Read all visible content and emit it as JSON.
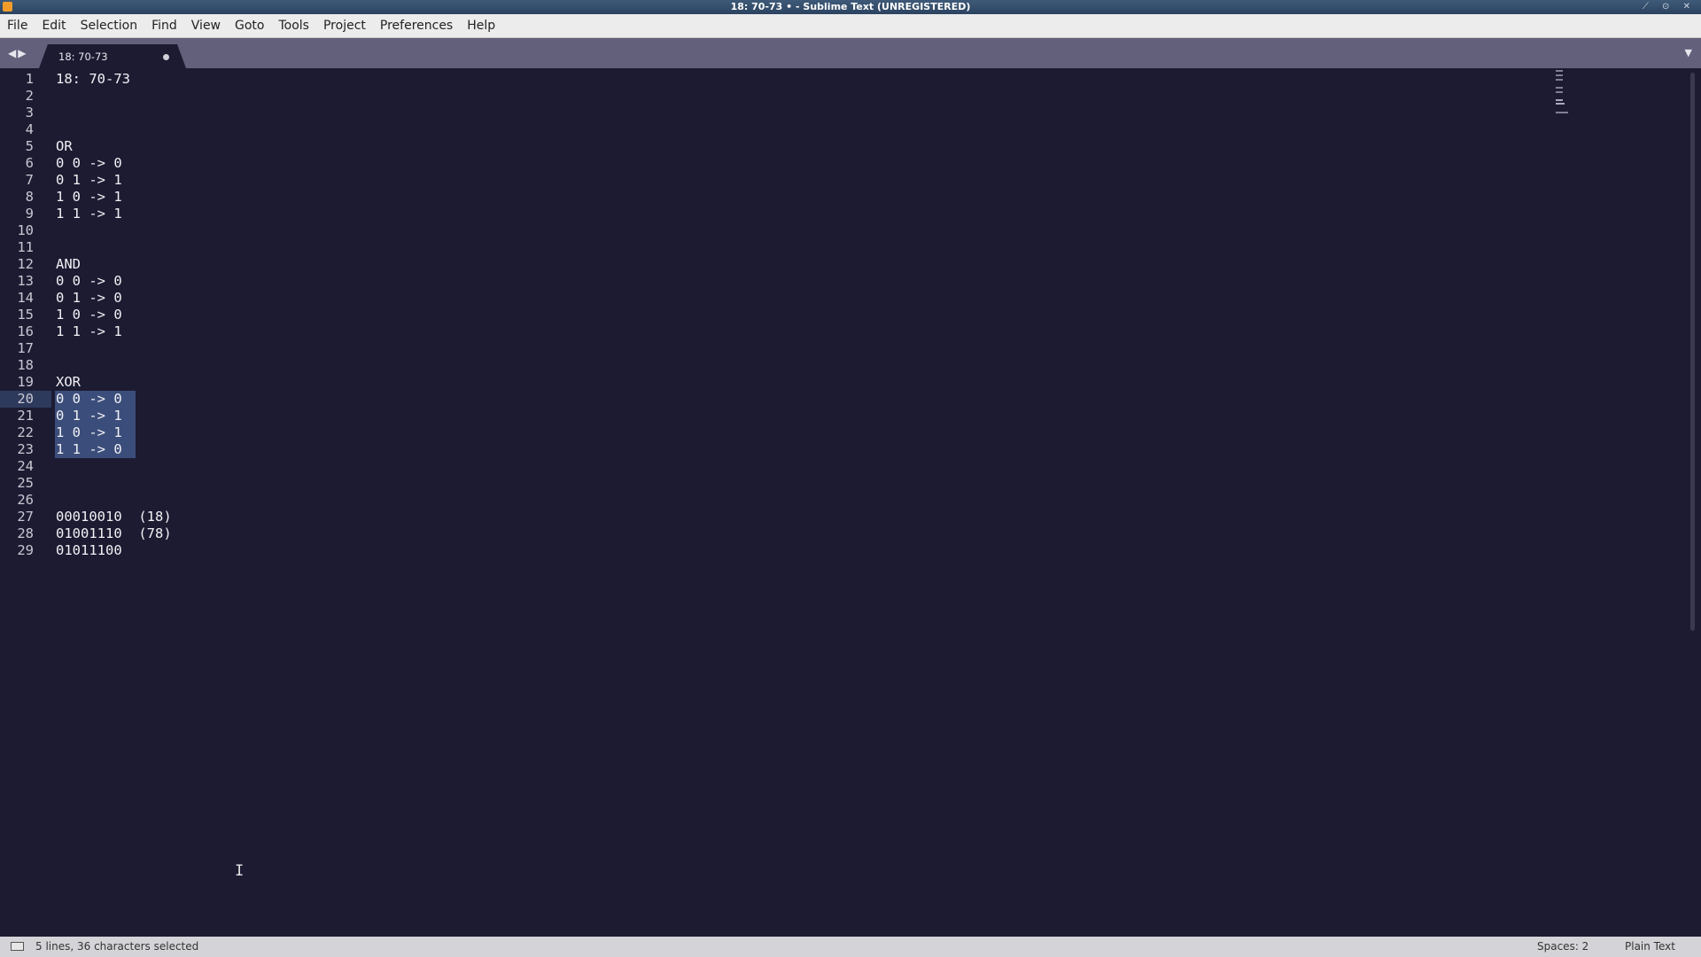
{
  "window": {
    "title": "18: 70-73 • - Sublime Text (UNREGISTERED)",
    "controls": "⟋ ⊙ ✕"
  },
  "menu": [
    "File",
    "Edit",
    "Selection",
    "Find",
    "View",
    "Goto",
    "Tools",
    "Project",
    "Preferences",
    "Help"
  ],
  "tabs": {
    "nav": "◀▶",
    "active_label": "18: 70-73",
    "dropdown": "▼"
  },
  "editor": {
    "current_line": 20,
    "selected_lines": [
      20,
      21,
      22,
      23
    ],
    "lines": [
      {
        "n": "1",
        "text": "18: 70-73"
      },
      {
        "n": "2",
        "text": ""
      },
      {
        "n": "3",
        "text": ""
      },
      {
        "n": "4",
        "text": ""
      },
      {
        "n": "5",
        "text": "OR"
      },
      {
        "n": "6",
        "text": "0 0 -> 0"
      },
      {
        "n": "7",
        "text": "0 1 -> 1"
      },
      {
        "n": "8",
        "text": "1 0 -> 1"
      },
      {
        "n": "9",
        "text": "1 1 -> 1"
      },
      {
        "n": "10",
        "text": ""
      },
      {
        "n": "11",
        "text": ""
      },
      {
        "n": "12",
        "text": "AND"
      },
      {
        "n": "13",
        "text": "0 0 -> 0"
      },
      {
        "n": "14",
        "text": "0 1 -> 0"
      },
      {
        "n": "15",
        "text": "1 0 -> 0"
      },
      {
        "n": "16",
        "text": "1 1 -> 1"
      },
      {
        "n": "17",
        "text": ""
      },
      {
        "n": "18",
        "text": ""
      },
      {
        "n": "19",
        "text": "XOR"
      },
      {
        "n": "20",
        "text": "0 0 -> 0"
      },
      {
        "n": "21",
        "text": "0 1 -> 1"
      },
      {
        "n": "22",
        "text": "1 0 -> 1"
      },
      {
        "n": "23",
        "text": "1 1 -> 0"
      },
      {
        "n": "24",
        "text": ""
      },
      {
        "n": "25",
        "text": ""
      },
      {
        "n": "26",
        "text": ""
      },
      {
        "n": "27",
        "text": "00010010  (18)"
      },
      {
        "n": "28",
        "text": "01001110  (78)"
      },
      {
        "n": "29",
        "text": "01011100"
      }
    ]
  },
  "status": {
    "selection": "5 lines, 36 characters selected",
    "spaces": "Spaces: 2",
    "syntax": "Plain Text"
  },
  "colors": {
    "editor_bg": "#1d1b32",
    "selection": "#3b4d7a",
    "text": "#f1f1f5"
  },
  "icons": {
    "app": "sublime-text-icon",
    "panel": "panel-switcher-icon",
    "cursor": "i-beam-cursor-icon"
  }
}
